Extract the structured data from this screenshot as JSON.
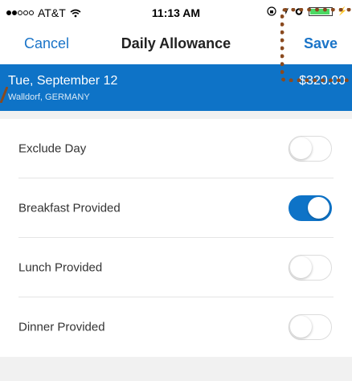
{
  "status_bar": {
    "carrier": "AT&T",
    "time": "11:13 AM",
    "signal_strength": 2,
    "battery_level": 0.88
  },
  "nav": {
    "cancel_label": "Cancel",
    "title": "Daily Allowance",
    "save_label": "Save"
  },
  "banner": {
    "date": "Tue, September 12",
    "location": "Walldorf, GERMANY",
    "amount": "$320.00"
  },
  "rows": [
    {
      "label": "Exclude Day",
      "on": false
    },
    {
      "label": "Breakfast Provided",
      "on": true
    },
    {
      "label": "Lunch Provided",
      "on": false
    },
    {
      "label": "Dinner Provided",
      "on": false
    }
  ],
  "colors": {
    "accent": "#0e73c7",
    "link": "#1a74c8",
    "callout": "#8a4a1f"
  }
}
